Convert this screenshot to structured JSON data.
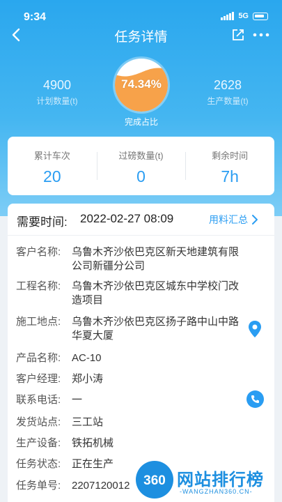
{
  "status": {
    "time": "9:34",
    "network": "5G"
  },
  "nav": {
    "title": "任务详情"
  },
  "hero": {
    "planned": {
      "value": "4900",
      "label": "计划数量(t)"
    },
    "percent": "74.34%",
    "progress": 0.7434,
    "percent_label": "完成占比",
    "produced": {
      "value": "2628",
      "label": "生产数量(t)"
    }
  },
  "summary": [
    {
      "label": "累计车次",
      "value": "20"
    },
    {
      "label": "过磅数量(t)",
      "value": "0"
    },
    {
      "label": "剩余时间",
      "value": "7h"
    }
  ],
  "detail": {
    "need_label": "需要时间:",
    "need_value": "2022-02-27 08:09",
    "link": "用料汇总",
    "rows": [
      {
        "key": "客户名称:",
        "value": "乌鲁木齐沙依巴克区新天地建筑有限公司新疆分公司"
      },
      {
        "key": "工程名称:",
        "value": "乌鲁木齐沙依巴克区城东中学校门改造项目"
      },
      {
        "key": "施工地点:",
        "value": "乌鲁木齐沙依巴克区扬子路中山中路华夏大厦"
      },
      {
        "key": "产品名称:",
        "value": "AC-10"
      },
      {
        "key": "客户经理:",
        "value": "郑小涛"
      },
      {
        "key": "联系电话:",
        "value": "一"
      },
      {
        "key": "发货站点:",
        "value": "三工站"
      },
      {
        "key": "生产设备:",
        "value": "铁拓机械"
      },
      {
        "key": "任务状态:",
        "value": "正在生产"
      },
      {
        "key": "任务单号:",
        "value": "2207120012"
      }
    ]
  },
  "watermark": {
    "badge": "360",
    "text": "网站排行榜",
    "sub": "-WANGZHAN360.CN-"
  },
  "colors": {
    "primary": "#2a9df2",
    "ring_fill": "#f7a24a"
  }
}
